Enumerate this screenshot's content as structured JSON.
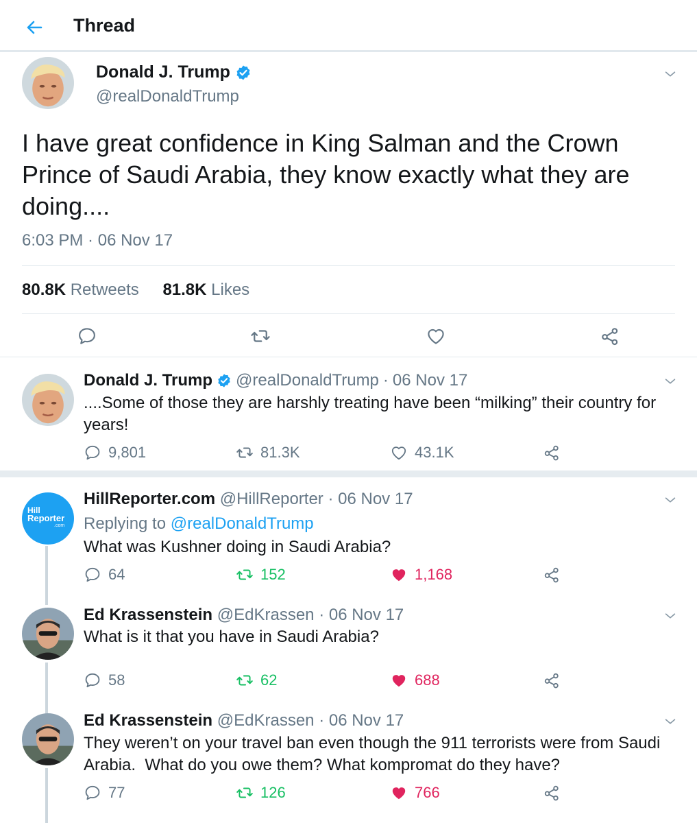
{
  "header": {
    "title": "Thread"
  },
  "main_tweet": {
    "name": "Donald J. Trump",
    "handle": "@realDonaldTrump",
    "text": "I have great confidence in King Salman and the Crown Prince of Saudi Arabia, they know exactly what they are doing....",
    "time": "6:03 PM",
    "date": "06 Nov 17",
    "retweets_count": "80.8K",
    "retweets_label": "Retweets",
    "likes_count": "81.8K",
    "likes_label": "Likes"
  },
  "second_tweet": {
    "name": "Donald J. Trump",
    "handle": "@realDonaldTrump",
    "date": "06 Nov 17",
    "text": "....Some of those they are harshly treating have been “milking” their country for years!",
    "replies": "9,801",
    "retweets": "81.3K",
    "likes": "43.1K"
  },
  "replies": [
    {
      "name": "HillReporter.com",
      "handle": "@HillReporter",
      "date": "06 Nov 17",
      "replying_label": "Replying to",
      "replying_to": "@realDonaldTrump",
      "text": "What was Kushner doing in Saudi Arabia?",
      "replies": "64",
      "retweets": "152",
      "likes": "1,168",
      "logo_line1": "Hill",
      "logo_line2": "Reporter",
      "logo_line3": ".com"
    },
    {
      "name": "Ed Krassenstein",
      "handle": "@EdKrassen",
      "date": "06 Nov 17",
      "text": "What is it that you have in Saudi Arabia?",
      "replies": "58",
      "retweets": "62",
      "likes": "688"
    },
    {
      "name": "Ed Krassenstein",
      "handle": "@EdKrassen",
      "date": "06 Nov 17",
      "text": "They weren’t on your travel ban even though the 911 terrorists were from Saudi Arabia.  What do you owe them? What kompromat do they have?",
      "replies": "77",
      "retweets": "126",
      "likes": "766"
    }
  ],
  "colors": {
    "accent": "#1da1f2",
    "retweet": "#17bf63",
    "like": "#e0245e",
    "muted": "#657786",
    "divider": "#e1e8ed"
  }
}
